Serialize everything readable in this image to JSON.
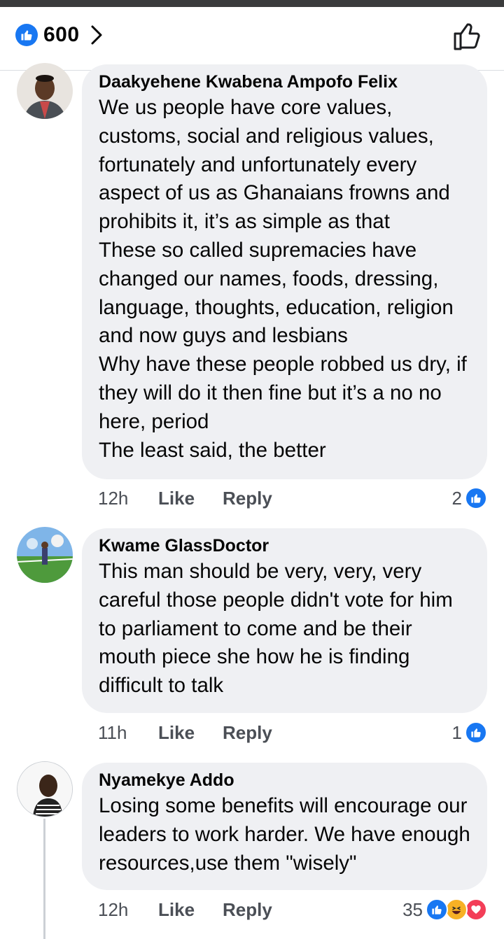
{
  "header": {
    "like_count": "600",
    "like_icon": "like-thumb-icon",
    "chevron_icon": "chevron-right-icon",
    "like_button_icon": "thumb-up-outline-icon"
  },
  "comments": [
    {
      "author": "Daakyehene Kwabena Ampofo Felix",
      "text": "We us people have core values, customs, social and religious values, fortunately and unfortunately every aspect of us as Ghanaians frowns and prohibits it, it’s as simple as that\nThese so called supremacies have changed our names, foods, dressing, language, thoughts, education, religion and now guys and lesbians\nWhy have these people robbed us dry, if they will do it then fine but it’s a no no here, period\nThe least said, the better",
      "time": "12h",
      "like_label": "Like",
      "reply_label": "Reply",
      "reaction_count": "2"
    },
    {
      "author": "Kwame GlassDoctor",
      "text": "This man should be very, very, very careful those people didn't vote for him to parliament to come and be their mouth piece she how he is finding difficult to talk",
      "time": "11h",
      "like_label": "Like",
      "reply_label": "Reply",
      "reaction_count": "1"
    },
    {
      "author": "Nyamekye Addo",
      "text": "Losing some benefits will encourage our leaders to work harder. We have enough resources,use them \"wisely\"",
      "time": "12h",
      "like_label": "Like",
      "reply_label": "Reply",
      "reaction_count": "35"
    }
  ],
  "colors": {
    "like_blue": "#1877f2",
    "haha_yellow": "#f7b125",
    "love_red": "#f33e58",
    "bubble": "#eff0f3"
  }
}
